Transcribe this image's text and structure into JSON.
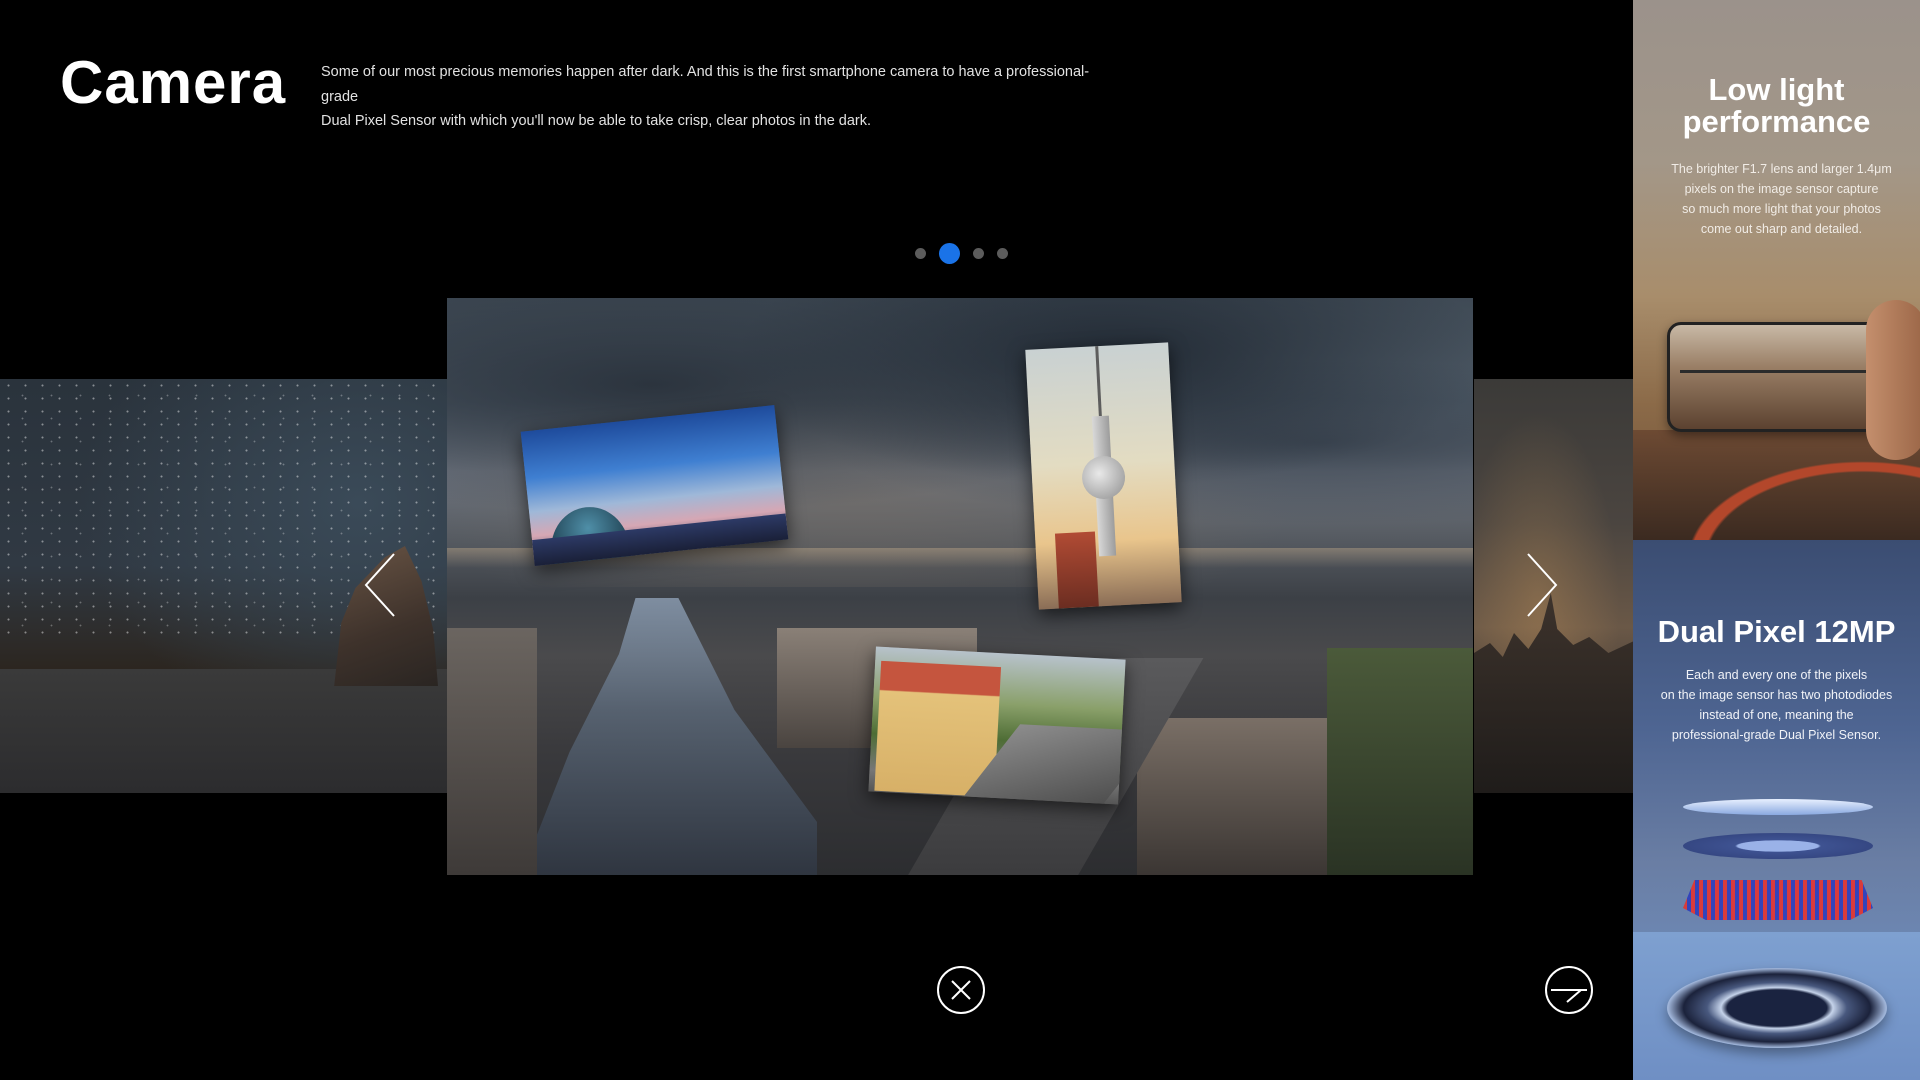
{
  "header": {
    "title": "Camera",
    "description_line1": "Some of our most precious memories happen after dark. And this is the first smartphone camera to have a professional-grade",
    "description_line2": "Dual Pixel Sensor with which you'll now be able to take crisp, clear photos in the dark."
  },
  "carousel": {
    "slide_count": 4,
    "active_slide": 2
  },
  "controls": {
    "prev_icon": "chevron-left-icon",
    "next_icon": "chevron-right-icon",
    "close_icon": "close-icon",
    "fullscreen_icon": "fullscreen-icon"
  },
  "features": {
    "low_light": {
      "heading_line1": "Low light",
      "heading_line2": "performance",
      "body_line1": "The brighter F1.7 lens and larger 1.4μm",
      "body_line2": "pixels on the image sensor capture",
      "body_line3": "so much more light that your photos",
      "body_line4": "come out sharp and detailed."
    },
    "dual_pixel": {
      "heading": "Dual Pixel 12MP",
      "body_line1": "Each and every one of the pixels",
      "body_line2": "on the image sensor has two photodiodes",
      "body_line3": "instead of one, meaning the",
      "body_line4": "professional-grade Dual Pixel Sensor."
    }
  },
  "colors": {
    "background": "#000000",
    "accent": "#1a73e8",
    "dot_inactive": "#5c5c5c"
  }
}
